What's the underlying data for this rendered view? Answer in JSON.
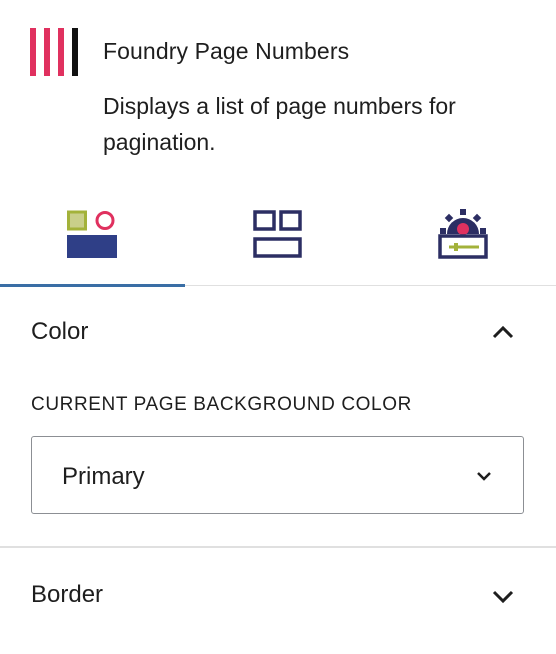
{
  "block": {
    "title": "Foundry Page Numbers",
    "description": "Displays a list of page numbers for pagination."
  },
  "tabs": [
    {
      "name": "styles",
      "icon": "styles-icon",
      "active": true
    },
    {
      "name": "layout",
      "icon": "layout-icon",
      "active": false
    },
    {
      "name": "settings",
      "icon": "settings-icon",
      "active": false
    }
  ],
  "color_panel": {
    "title": "Color",
    "expanded": true,
    "field_label": "CURRENT PAGE BACKGROUND COLOR",
    "selected_value": "Primary"
  },
  "border_panel": {
    "title": "Border",
    "expanded": false
  },
  "colors": {
    "accent": "#3a6ea5",
    "brand_pink": "#e0315f",
    "navy": "#2c2e63",
    "olive": "#a3b23a",
    "border": "#e0e0e0"
  }
}
